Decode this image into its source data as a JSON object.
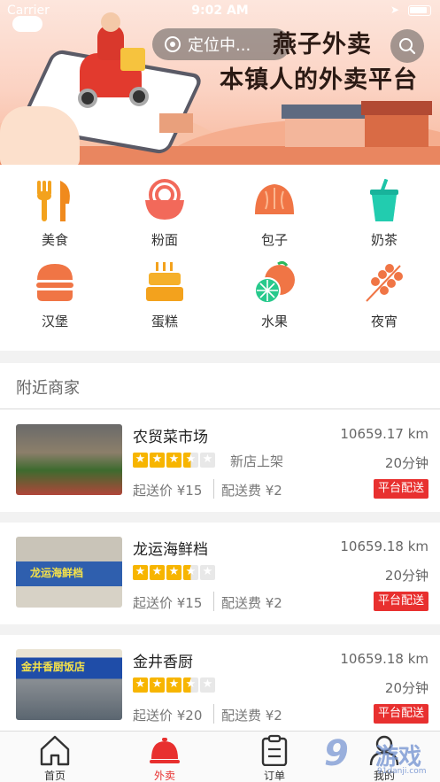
{
  "status_bar": {
    "carrier": "Carrier",
    "time": "9:02 AM"
  },
  "header": {
    "location_label": "定位中...",
    "slogan_line1": "燕子外卖",
    "slogan_line2": "本镇人的外卖平台"
  },
  "categories": [
    {
      "label": "美食",
      "icon": "fork-knife-icon"
    },
    {
      "label": "粉面",
      "icon": "noodle-bowl-icon"
    },
    {
      "label": "包子",
      "icon": "bun-icon"
    },
    {
      "label": "奶茶",
      "icon": "milk-tea-icon"
    },
    {
      "label": "汉堡",
      "icon": "burger-icon"
    },
    {
      "label": "蛋糕",
      "icon": "cake-icon"
    },
    {
      "label": "水果",
      "icon": "fruit-icon"
    },
    {
      "label": "夜宵",
      "icon": "skewer-icon"
    }
  ],
  "nearby": {
    "title": "附近商家",
    "shops": [
      {
        "name": "农贸菜市场",
        "distance": "10659.17 km",
        "rating": 3.5,
        "tag": "新店上架",
        "time": "20分钟",
        "min_order": "起送价 ¥15",
        "delivery_fee": "配送费 ¥2",
        "delivery": "平台配送",
        "thumb_text": ""
      },
      {
        "name": "龙运海鲜档",
        "distance": "10659.18 km",
        "rating": 3.5,
        "tag": "",
        "time": "20分钟",
        "min_order": "起送价 ¥15",
        "delivery_fee": "配送费 ¥2",
        "delivery": "平台配送",
        "thumb_text": "龙运海鲜档"
      },
      {
        "name": "金井香厨",
        "distance": "10659.18 km",
        "rating": 3.5,
        "tag": "",
        "time": "20分钟",
        "min_order": "起送价 ¥20",
        "delivery_fee": "配送费 ¥2",
        "delivery": "平台配送",
        "thumb_text": "金井香厨饭店"
      }
    ]
  },
  "tabbar": [
    {
      "label": "首页",
      "icon": "home-icon",
      "active": false
    },
    {
      "label": "外卖",
      "icon": "cloche-icon",
      "active": true
    },
    {
      "label": "订单",
      "icon": "clipboard-icon",
      "active": false
    },
    {
      "label": "我的",
      "icon": "person-icon",
      "active": false
    }
  ],
  "watermark": {
    "number": "9",
    "text": "游戏",
    "url": "91danji.com"
  },
  "colors": {
    "accent": "#e8302f",
    "orange": "#f08a3e",
    "star": "#f7b500"
  }
}
